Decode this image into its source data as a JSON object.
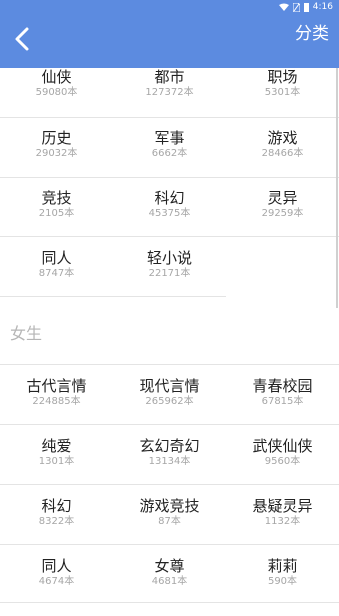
{
  "status": {
    "time": "4:16"
  },
  "header": {
    "title": "分类"
  },
  "male": {
    "rows": [
      [
        {
          "name": "仙侠",
          "count": "59080本"
        },
        {
          "name": "都市",
          "count": "127372本"
        },
        {
          "name": "职场",
          "count": "5301本"
        }
      ],
      [
        {
          "name": "历史",
          "count": "29032本"
        },
        {
          "name": "军事",
          "count": "6662本"
        },
        {
          "name": "游戏",
          "count": "28466本"
        }
      ],
      [
        {
          "name": "竞技",
          "count": "2105本"
        },
        {
          "name": "科幻",
          "count": "45375本"
        },
        {
          "name": "灵异",
          "count": "29259本"
        }
      ],
      [
        {
          "name": "同人",
          "count": "8747本"
        },
        {
          "name": "轻小说",
          "count": "22171本"
        }
      ]
    ]
  },
  "female": {
    "label": "女生",
    "rows": [
      [
        {
          "name": "古代言情",
          "count": "224885本"
        },
        {
          "name": "现代言情",
          "count": "265962本"
        },
        {
          "name": "青春校园",
          "count": "67815本"
        }
      ],
      [
        {
          "name": "纯爱",
          "count": "1301本"
        },
        {
          "name": "玄幻奇幻",
          "count": "13134本"
        },
        {
          "name": "武侠仙侠",
          "count": "9560本"
        }
      ],
      [
        {
          "name": "科幻",
          "count": "8322本"
        },
        {
          "name": "游戏竞技",
          "count": "87本"
        },
        {
          "name": "悬疑灵异",
          "count": "1132本"
        }
      ],
      [
        {
          "name": "同人",
          "count": "4674本"
        },
        {
          "name": "女尊",
          "count": "4681本"
        },
        {
          "name": "莉莉",
          "count": "590本"
        }
      ]
    ]
  }
}
